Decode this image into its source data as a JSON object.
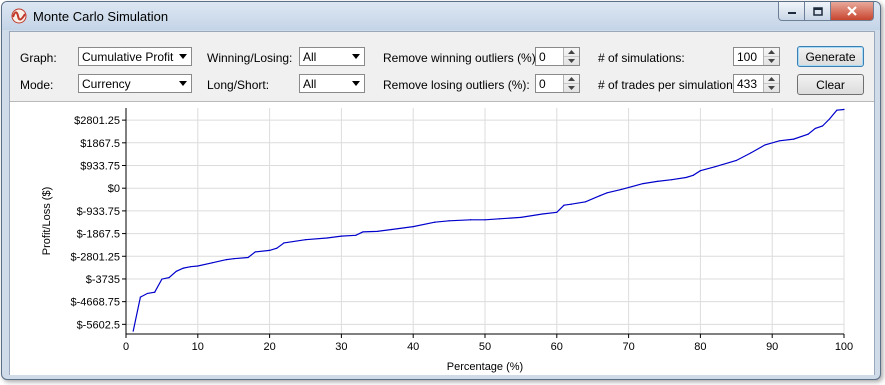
{
  "window": {
    "title": "Monte Carlo Simulation"
  },
  "controls": {
    "graph_label": "Graph:",
    "graph_value": "Cumulative Profit",
    "mode_label": "Mode:",
    "mode_value": "Currency",
    "winning_losing_label": "Winning/Losing:",
    "winning_losing_value": "All",
    "long_short_label": "Long/Short:",
    "long_short_value": "All",
    "remove_winning_label": "Remove winning outliers (%):",
    "remove_winning_value": "0",
    "remove_losing_label": "Remove losing outliers (%):",
    "remove_losing_value": "0",
    "num_simulations_label": "# of simulations:",
    "num_simulations_value": "100",
    "trades_per_sim_label": "# of trades per simulation:",
    "trades_per_sim_value": "433",
    "generate_label": "Generate",
    "clear_label": "Clear"
  },
  "chart_data": {
    "type": "line",
    "xlabel": "Percentage (%)",
    "ylabel": "Profit/Loss ($)",
    "xlim": [
      0,
      100
    ],
    "ylim": [
      -6000,
      3300
    ],
    "x_ticks": [
      "0",
      "10",
      "20",
      "30",
      "40",
      "50",
      "60",
      "70",
      "80",
      "90",
      "100"
    ],
    "x_tick_values": [
      0,
      10,
      20,
      30,
      40,
      50,
      60,
      70,
      80,
      90,
      100
    ],
    "y_ticks": [
      "$2801.25",
      "$1867.5",
      "$933.75",
      "$0",
      "$-933.75",
      "$-1867.5",
      "$-2801.25",
      "$-3735",
      "$-4668.75",
      "$-5602.5"
    ],
    "y_tick_values": [
      2801.25,
      1867.5,
      933.75,
      0,
      -933.75,
      -1867.5,
      -2801.25,
      -3735,
      -4668.75,
      -5602.5
    ],
    "grid": true,
    "line_color": "#0000cc",
    "x": [
      1,
      2,
      3,
      4,
      5,
      6,
      7,
      8,
      9,
      10,
      12,
      14,
      15,
      17,
      18,
      20,
      21,
      22,
      25,
      28,
      30,
      32,
      33,
      35,
      37,
      40,
      43,
      45,
      48,
      50,
      52,
      55,
      58,
      60,
      61,
      62,
      64,
      66,
      67,
      69,
      72,
      74,
      76,
      78,
      79,
      80,
      82,
      85,
      87,
      89,
      91,
      93,
      95,
      96,
      97,
      98,
      99,
      100
    ],
    "y": [
      -5880,
      -4480,
      -4330,
      -4280,
      -3740,
      -3680,
      -3420,
      -3290,
      -3230,
      -3200,
      -3070,
      -2940,
      -2900,
      -2850,
      -2620,
      -2560,
      -2470,
      -2250,
      -2120,
      -2050,
      -1970,
      -1940,
      -1800,
      -1780,
      -1700,
      -1580,
      -1400,
      -1340,
      -1300,
      -1300,
      -1260,
      -1200,
      -1060,
      -990,
      -700,
      -660,
      -560,
      -310,
      -190,
      -50,
      190,
      280,
      350,
      440,
      530,
      720,
      880,
      1140,
      1450,
      1780,
      1950,
      2020,
      2220,
      2460,
      2560,
      2850,
      3210,
      3240
    ]
  }
}
